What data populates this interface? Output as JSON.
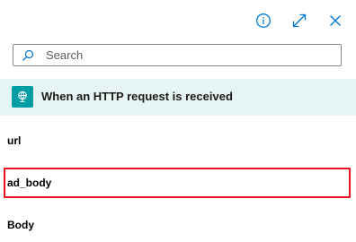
{
  "header": {
    "icons": [
      "info-icon",
      "expand-icon",
      "close-icon"
    ],
    "accent_color": "#0078d4"
  },
  "search": {
    "placeholder": "Search",
    "value": ""
  },
  "trigger": {
    "label": "When an HTTP request is received",
    "icon": "http-request-icon",
    "icon_bg": "#009da5",
    "row_bg": "#e6f4f4"
  },
  "tokens": [
    {
      "label": "url"
    },
    {
      "label": "ad_body"
    },
    {
      "label": "Body"
    }
  ],
  "highlight_color": "#e81123"
}
